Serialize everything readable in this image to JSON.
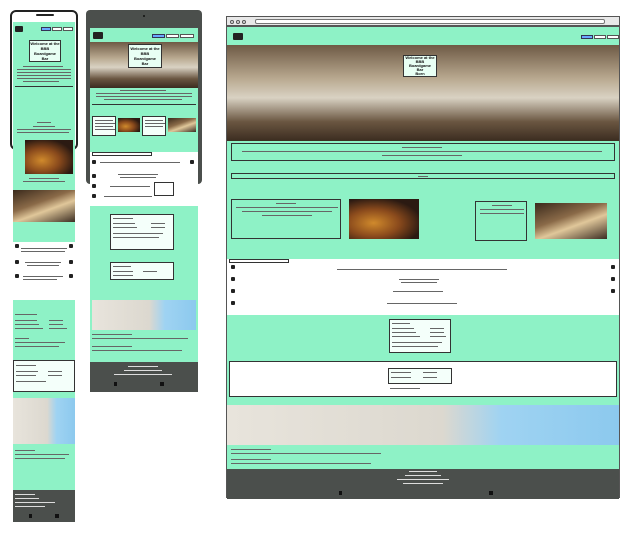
{
  "screens": {
    "mobile": {
      "name": "mobile-mockup"
    },
    "tablet": {
      "name": "tablet-mockup"
    },
    "desktop": {
      "name": "desktop-mockup"
    }
  },
  "hero": {
    "title_line1": "Welcome at the",
    "title_line2": "BBB",
    "title_line3": "Boardgame",
    "title_line4": "Bar",
    "desktop_title_line1": "Welcome at the",
    "desktop_title_line2": "BBB",
    "desktop_title_line3": "Boardgame",
    "desktop_title_line4": "Bar",
    "desktop_title_line5": "Born"
  },
  "nav": {
    "btn1": "",
    "btn2": "",
    "btn3": ""
  },
  "browser": {
    "address": ""
  },
  "colors": {
    "mint": "#8ef2c6",
    "footer": "#4b4f4c",
    "accent_button": "#6aa8ff"
  }
}
